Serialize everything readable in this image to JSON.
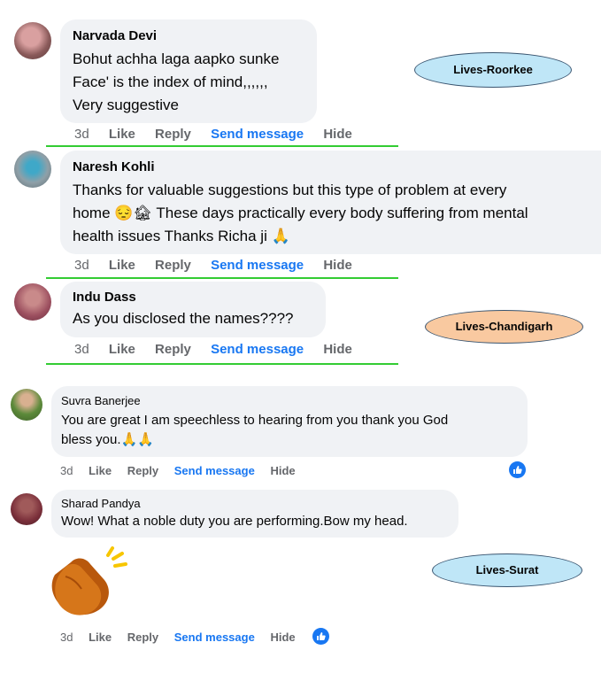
{
  "comments": [
    {
      "name": "Narvada Devi",
      "lines": [
        "Bohut achha laga aapko sunke",
        "Face' is the index of mind,,,,,,",
        "Very suggestive"
      ],
      "time": "3d",
      "like": "Like",
      "reply": "Reply",
      "send": "Send message",
      "hide": "Hide"
    },
    {
      "name": "Naresh Kohli",
      "lines": [
        "Thanks for valuable suggestions but this type of problem at every",
        "home 😔🏚 These days practically every body suffering from mental",
        "health issues Thanks Richa ji 🙏"
      ],
      "time": "3d",
      "like": "Like",
      "reply": "Reply",
      "send": "Send message",
      "hide": "Hide"
    },
    {
      "name": "Indu Dass",
      "lines": [
        "As you disclosed the names????"
      ],
      "time": "3d",
      "like": "Like",
      "reply": "Reply",
      "send": "Send message",
      "hide": "Hide"
    },
    {
      "name": "Suvra Banerjee",
      "lines": [
        "You are great I am speechless to hearing from you thank you God",
        "bless you.🙏🙏"
      ],
      "time": "3d",
      "like": "Like",
      "reply": "Reply",
      "send": "Send message",
      "hide": "Hide"
    },
    {
      "name": "Sharad Pandya",
      "lines": [
        "Wow! What a noble duty you are performing.Bow my head."
      ],
      "time": "3d",
      "like": "Like",
      "reply": "Reply",
      "send": "Send message",
      "hide": "Hide"
    }
  ],
  "tags": {
    "roorkee": "Lives-Roorkee",
    "chandigarh": "Lives-Chandigarh",
    "surat": "Lives-Surat"
  },
  "colors": {
    "bubble": "#f0f2f5",
    "link": "#1877f2",
    "meta": "#65676b",
    "divider": "#33cc33",
    "tag_blue": "#bfe6f7",
    "tag_orange": "#f9c9a0"
  },
  "icons": [
    "thumbs-up-icon",
    "clapping-hands-sticker"
  ]
}
